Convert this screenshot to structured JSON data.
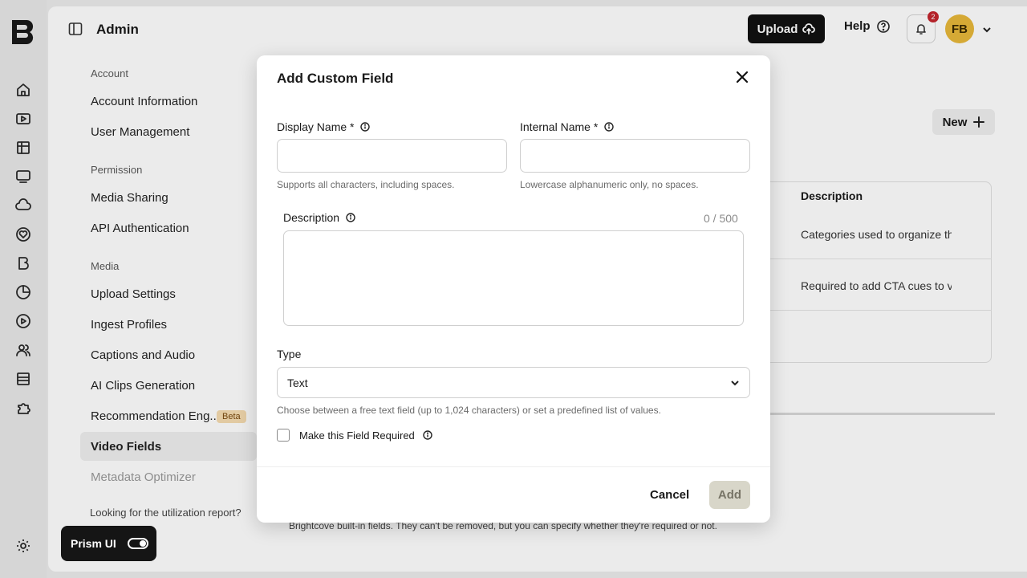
{
  "header": {
    "title": "Admin",
    "upload_label": "Upload",
    "help_label": "Help",
    "notification_count": "2",
    "avatar_initials": "FB"
  },
  "sidebar": {
    "sections": [
      {
        "label": "Account",
        "items": [
          "Account Information",
          "User Management"
        ]
      },
      {
        "label": "Permission",
        "items": [
          "Media Sharing",
          "API Authentication"
        ]
      },
      {
        "label": "Media",
        "items": [
          "Upload Settings",
          "Ingest Profiles",
          "Captions and Audio",
          "AI Clips Generation",
          "Recommendation Eng...",
          "Video Fields",
          "Metadata Optimizer"
        ]
      }
    ],
    "beta_badge": "Beta",
    "active_item": "Video Fields",
    "utilization_note": "Looking for the utilization report?"
  },
  "background": {
    "new_button": "New",
    "column_header": "Description",
    "rows": [
      "Categories used to organize th",
      "Required to add CTA cues to v"
    ],
    "footer_note": "Brightcove built-in fields. They can't be removed, but you can specify whether they're required or not."
  },
  "prism": {
    "label": "Prism UI",
    "enabled": true
  },
  "modal": {
    "title": "Add Custom Field",
    "display_name_label": "Display Name *",
    "display_name_value": "",
    "display_name_hint": "Supports all characters, including spaces.",
    "internal_name_label": "Internal Name *",
    "internal_name_value": "",
    "internal_name_hint": "Lowercase alphanumeric only, no spaces.",
    "description_label": "Description",
    "description_counter": "0 / 500",
    "description_value": "",
    "type_label": "Type",
    "type_value": "Text",
    "type_hint": "Choose between a free text field (up to 1,024 characters) or set a predefined list of values.",
    "required_label": "Make this Field Required",
    "required_checked": false,
    "cancel_label": "Cancel",
    "add_label": "Add"
  },
  "colors": {
    "primary_dark": "#111111",
    "badge_red": "#c4262e",
    "avatar_yellow": "#e8b83a",
    "disabled_button": "#d8d6c9"
  }
}
